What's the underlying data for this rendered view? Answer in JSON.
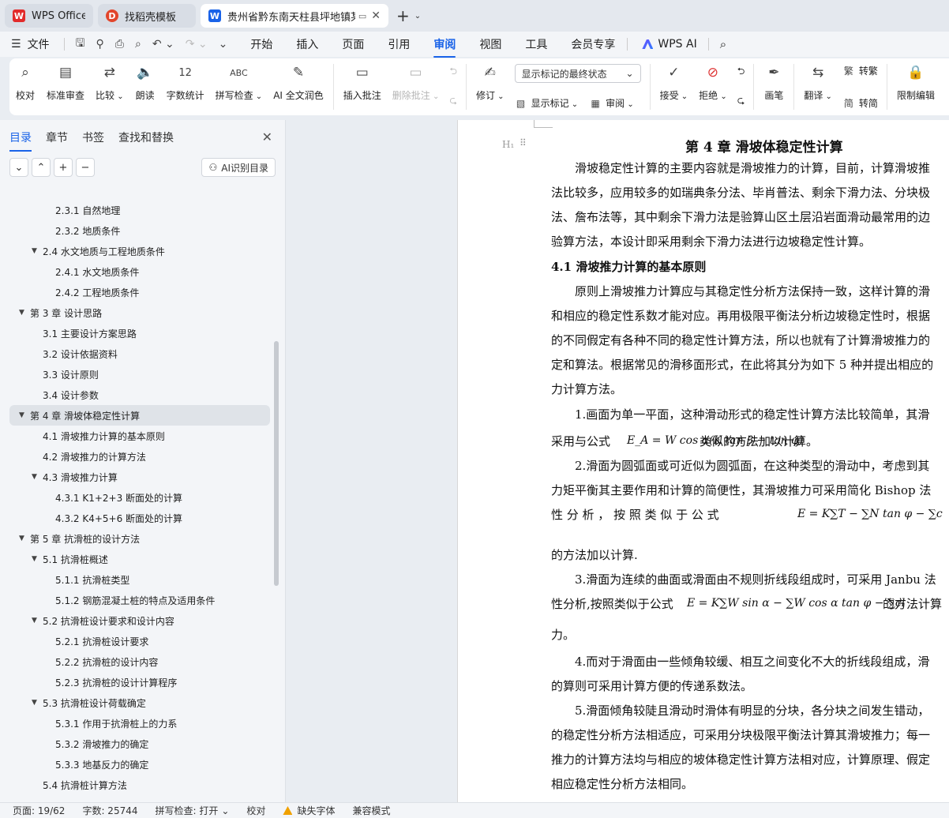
{
  "tabs": [
    {
      "label": "WPS Office",
      "logo": "W",
      "color": "#e22b2b"
    },
    {
      "label": "找稻壳模板",
      "logo": "D",
      "color": "#e2452b"
    },
    {
      "label": "贵州省黔东南天柱县坪地镇某",
      "logo": "W",
      "color": "#1a63e8"
    }
  ],
  "menu": {
    "file": "文件",
    "nav": [
      "开始",
      "插入",
      "页面",
      "引用",
      "审阅",
      "视图",
      "工具",
      "会员专享"
    ],
    "active": "审阅",
    "wps_ai": "WPS AI"
  },
  "ribbon": {
    "proofread": "校对",
    "standard_review": "标准审查",
    "compare": "比较",
    "read_aloud": "朗读",
    "word_count": "字数统计",
    "spell_check": "拼写检查",
    "ai_polish": "AI 全文润色",
    "insert_comment": "插入批注",
    "delete_comment": "删除批注",
    "revise": "修订",
    "markup_select": "显示标记的最终状态",
    "show_markup": "显示标记",
    "review": "审阅",
    "accept": "接受",
    "reject": "拒绝",
    "pen": "画笔",
    "translate": "翻译",
    "to_traditional": "转繁",
    "to_simplified": "转简",
    "restrict_edit": "限制编辑"
  },
  "sidebar": {
    "tabs": [
      "目录",
      "章节",
      "书签",
      "查找和替换"
    ],
    "ai_button": "AI识别目录",
    "toc": [
      {
        "text": "2.3.1 自然地理",
        "level": 3
      },
      {
        "text": "2.3.2 地质条件",
        "level": 3
      },
      {
        "text": "2.4 水文地质与工程地质条件",
        "level": 2,
        "exp": true
      },
      {
        "text": "2.4.1 水文地质条件",
        "level": 3
      },
      {
        "text": "2.4.2 工程地质条件",
        "level": 3
      },
      {
        "text": "第 3 章  设计思路",
        "level": 1,
        "exp": true
      },
      {
        "text": "3.1  主要设计方案思路",
        "level": 2
      },
      {
        "text": "3.2  设计依据资料",
        "level": 2
      },
      {
        "text": "3.3 设计原则",
        "level": 2
      },
      {
        "text": "3.4 设计参数",
        "level": 2
      },
      {
        "text": "第 4 章  滑坡体稳定性计算",
        "level": 1,
        "exp": true,
        "selected": true
      },
      {
        "text": "4.1  滑坡推力计算的基本原则",
        "level": 2
      },
      {
        "text": "4.2  滑坡推力的计算方法",
        "level": 2
      },
      {
        "text": "4.3  滑坡推力计算",
        "level": 2,
        "exp": true
      },
      {
        "text": "4.3.1 K1+2+3 断面处的计算",
        "level": 3
      },
      {
        "text": "4.3.2 K4+5+6 断面处的计算",
        "level": 3
      },
      {
        "text": "第 5 章  抗滑桩的设计方法",
        "level": 1,
        "exp": true
      },
      {
        "text": "5.1  抗滑桩概述",
        "level": 2,
        "exp": true
      },
      {
        "text": "5.1.1  抗滑桩类型",
        "level": 3
      },
      {
        "text": "5.1.2  钢筋混凝土桩的特点及适用条件",
        "level": 3
      },
      {
        "text": "5.2  抗滑桩设计要求和设计内容",
        "level": 2,
        "exp": true
      },
      {
        "text": "5.2.1  抗滑桩设计要求",
        "level": 3
      },
      {
        "text": "5.2.2  抗滑桩的设计内容",
        "level": 3
      },
      {
        "text": "5.2.3  抗滑桩的设计计算程序",
        "level": 3
      },
      {
        "text": "5.3  抗滑桩设计荷载确定",
        "level": 2,
        "exp": true
      },
      {
        "text": "5.3.1  作用于抗滑桩上的力系",
        "level": 3
      },
      {
        "text": "5.3.2  滑坡推力的确定",
        "level": 3
      },
      {
        "text": "5.3.3  地基反力的确定",
        "level": 3
      },
      {
        "text": "5.4  抗滑桩计算方法",
        "level": 2
      }
    ]
  },
  "document": {
    "chapter_title": "第 4 章  滑坡体稳定性计算",
    "lines": [
      "　　滑坡稳定性计算的主要内容就是滑坡推力的计算，目前，计算滑坡推",
      "法比较多，应用较多的如瑞典条分法、毕肖普法、剩余下滑力法、分块极",
      "法、詹布法等，其中剩余下滑力法是验算山区土层沿岩面滑动最常用的边",
      "验算方法，本设计即采用剩余下滑力法进行边坡稳定性计算。",
      "4.1  滑坡推力计算的基本原则",
      "　　原则上滑坡推力计算应与其稳定性分析方法保持一致，这样计算的滑",
      "和相应的稳定性系数才能对应。再用极限平衡法分析边坡稳定性时，根据",
      "的不同假定有各种不同的稳定性计算方法，所以也就有了计算滑坡推力的",
      "定和算法。根据常见的滑移面形式，在此将其分为如下 5 种并提出相应的",
      "力计算方法。",
      "　　1.画面为单一平面，这种滑动形式的稳定性计算方法比较简单，其滑",
      "采用与公式 ",
      "类似的方法加以计算。",
      "　　2.滑面为圆弧面或可近似为圆弧面，在这种类型的滑动中，考虑到其",
      "力矩平衡其主要作用和计算的简便性，其滑坡推力可采用简化 Bishop 法",
      "性  分  析  ，  按  照  类  似  于  公  式  ",
      "的方法加以计算.",
      "　　3.滑面为连续的曲面或滑面由不规则折线段组成时，可采用 Janbu 法",
      "性分析,按照类似于公式 ",
      " 的方法计算",
      "力。",
      "　　4.而对于滑面由一些倾角较缓、相互之间变化不大的折线段组成，滑",
      "的算则可采用计算方便的传递系数法。",
      "　　5.滑面倾角较陡且滑动时滑体有明显的分块，各分块之间发生错动，",
      "的稳定性分析方法相适应，可采用分块极限平衡法计算其滑坡推力；每一",
      "推力的计算方法均与相应的坡体稳定性计算方法相对应，计算原理、假定",
      "相应稳定性分析方法相同。"
    ],
    "formula1": "E_A = W cos α(K tan β − tan φ)",
    "formula2": "E = K∑T − ∑N tan φ − ∑c",
    "formula3": "E = K∑W sin α − ∑W cos α tan φ − ∑cl"
  },
  "status": {
    "page": "页面: 19/62",
    "words": "字数: 25744",
    "spell": "拼写检查: 打开",
    "proof": "校对",
    "missing_font": "缺失字体",
    "compat": "兼容模式"
  }
}
